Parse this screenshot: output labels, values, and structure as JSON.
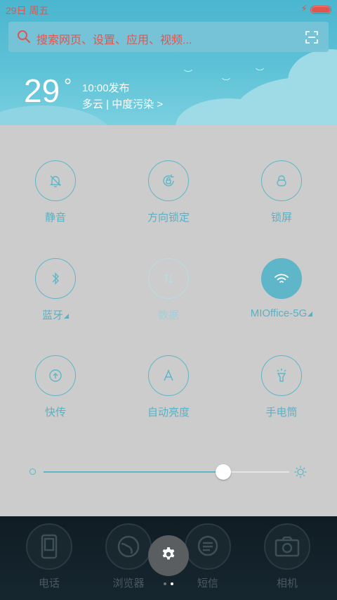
{
  "status_bar": {
    "date": "29日 周五"
  },
  "search": {
    "placeholder": "搜索网页、设置、应用、视频..."
  },
  "weather": {
    "temperature": "29",
    "degree": "°",
    "publish_time": "10:00发布",
    "description": "多云 | 中度污染 >"
  },
  "tiles": [
    {
      "label": "静音",
      "icon": "bell-off-icon",
      "state": "off"
    },
    {
      "label": "方向锁定",
      "icon": "rotation-lock-icon",
      "state": "off"
    },
    {
      "label": "锁屏",
      "icon": "lock-icon",
      "state": "off"
    },
    {
      "label": "蓝牙",
      "icon": "bluetooth-icon",
      "state": "off",
      "has_more": true
    },
    {
      "label": "数据",
      "icon": "mobile-data-icon",
      "state": "disabled"
    },
    {
      "label": "MIOffice-5G",
      "icon": "wifi-icon",
      "state": "on",
      "has_more": true
    },
    {
      "label": "快传",
      "icon": "transfer-icon",
      "state": "off"
    },
    {
      "label": "自动亮度",
      "icon": "auto-brightness-icon",
      "state": "off"
    },
    {
      "label": "手电筒",
      "icon": "flashlight-icon",
      "state": "off"
    }
  ],
  "brightness": {
    "level": 0.73
  },
  "dock": {
    "apps": [
      {
        "name": "电话",
        "icon": "phone-icon"
      },
      {
        "name": "浏览器",
        "icon": "browser-icon"
      },
      {
        "name": "短信",
        "icon": "message-icon"
      },
      {
        "name": "相机",
        "icon": "camera-icon"
      }
    ]
  },
  "colors": {
    "accent": "#5eb6c8",
    "status_text": "#e0564f",
    "panel_bg": "#cccccc",
    "header_bg": "#56bcd3"
  }
}
